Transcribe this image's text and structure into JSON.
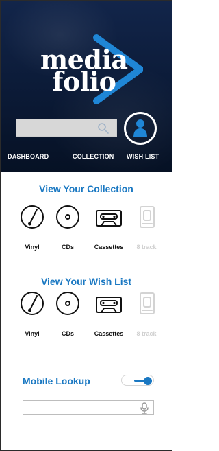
{
  "brand": {
    "line1": "media",
    "line2": "folio"
  },
  "header": {
    "search": {
      "placeholder": "",
      "value": ""
    },
    "nav": {
      "dashboard": "DASHBOARD",
      "collection": "COLLECTION",
      "wishlist": "WISH LIST"
    }
  },
  "sections": {
    "collection": {
      "title": "View Your Collection",
      "items": [
        {
          "label": "Vinyl",
          "icon": "vinyl-icon",
          "enabled": true
        },
        {
          "label": "CDs",
          "icon": "cd-icon",
          "enabled": true
        },
        {
          "label": "Cassettes",
          "icon": "cassette-icon",
          "enabled": true
        },
        {
          "label": "8 track",
          "icon": "eight-track-icon",
          "enabled": false
        }
      ]
    },
    "wishlist": {
      "title": "View Your Wish List",
      "items": [
        {
          "label": "Vinyl",
          "icon": "vinyl-icon",
          "enabled": true
        },
        {
          "label": "CDs",
          "icon": "cd-icon",
          "enabled": true
        },
        {
          "label": "Cassettes",
          "icon": "cassette-icon",
          "enabled": true
        },
        {
          "label": "8 track",
          "icon": "eight-track-icon",
          "enabled": false
        }
      ]
    }
  },
  "mobile": {
    "title": "Mobile Lookup",
    "toggle_on": true,
    "lookup": {
      "placeholder": "",
      "value": ""
    }
  },
  "colors": {
    "accent": "#1a78c2",
    "header_bg": "#0b1a36",
    "disabled": "#cfcfcf"
  }
}
